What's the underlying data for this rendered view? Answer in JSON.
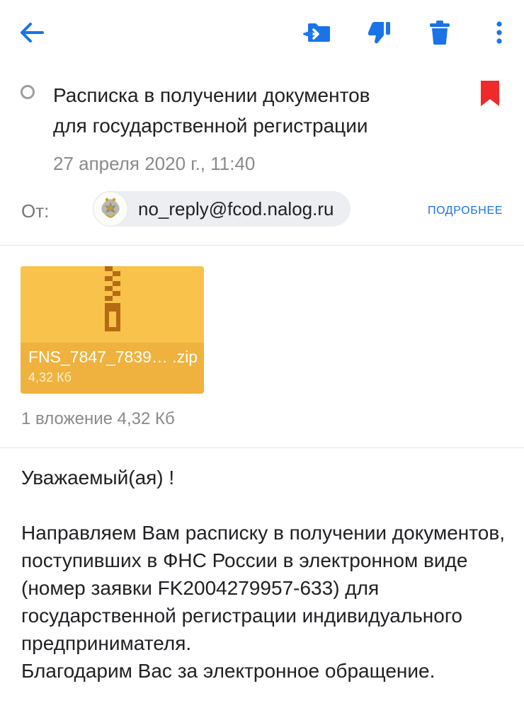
{
  "toolbar": {
    "back_icon": "arrow-left-icon",
    "move_icon": "move-to-folder-icon",
    "spam_icon": "thumbs-down-icon",
    "delete_icon": "trash-icon",
    "more_icon": "more-vertical-icon",
    "accent_color": "#1a73e8"
  },
  "message": {
    "subject": "Расписка в получении документов\nдля государственной регистрации",
    "date": "27 апреля 2020 г., 11:40",
    "flag_color": "#ee2a2a",
    "from_label": "От:",
    "sender_email": "no_reply@fcod.nalog.ru",
    "details_label": "ПОДРОБНЕЕ"
  },
  "attachments": {
    "items": [
      {
        "name": "FNS_7847_7839… .zip",
        "size": "4,32  Кб",
        "icon": "zip-archive-icon"
      }
    ],
    "summary": "1 вложение 4,32  Кб"
  },
  "body": {
    "greeting": "Уважаемый(ая) !",
    "paragraph1": "Направляем Вам расписку в получении документов, поступивших в ФНС России в электронном виде (номер заявки FK2004279957-633) для государственной регистрации индивидуального предпринимателя.",
    "paragraph2": "Благодарим Вас за электронное обращение."
  }
}
